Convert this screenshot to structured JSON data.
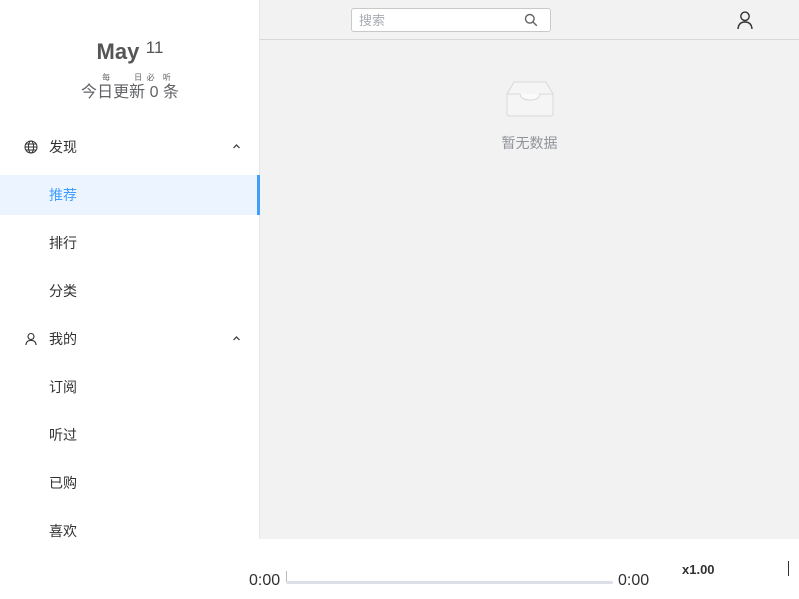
{
  "date": {
    "month": "May",
    "day": "11"
  },
  "update": {
    "chars": [
      {
        "char": "今",
        "ruby": ""
      },
      {
        "char": "日",
        "ruby": "每"
      },
      {
        "char": "更",
        "ruby": ""
      },
      {
        "char": "新",
        "ruby": "日"
      },
      {
        "char": "0",
        "ruby": "必"
      },
      {
        "char": "条",
        "ruby": "听"
      }
    ]
  },
  "sidebar": {
    "discover": {
      "label": "发现",
      "icon": "globe-icon",
      "items": [
        {
          "label": "推荐",
          "active": true
        },
        {
          "label": "排行",
          "active": false
        },
        {
          "label": "分类",
          "active": false
        }
      ]
    },
    "mine": {
      "label": "我的",
      "icon": "user-icon",
      "items": [
        {
          "label": "订阅",
          "active": false
        },
        {
          "label": "听过",
          "active": false
        },
        {
          "label": "已购",
          "active": false
        },
        {
          "label": "喜欢",
          "active": false
        }
      ]
    }
  },
  "header": {
    "search": {
      "placeholder": "搜索",
      "value": "",
      "icon": "search-icon"
    },
    "user_icon": "user-icon"
  },
  "main": {
    "empty_text": "暂无数据",
    "empty_icon": "inbox-icon"
  },
  "player": {
    "current_time": "0:00",
    "duration": "0:00",
    "progress": 0,
    "speed": "x1.00"
  },
  "colors": {
    "accent": "#409eff",
    "active_bg": "#ecf5ff",
    "main_bg": "#f2f2f2"
  }
}
